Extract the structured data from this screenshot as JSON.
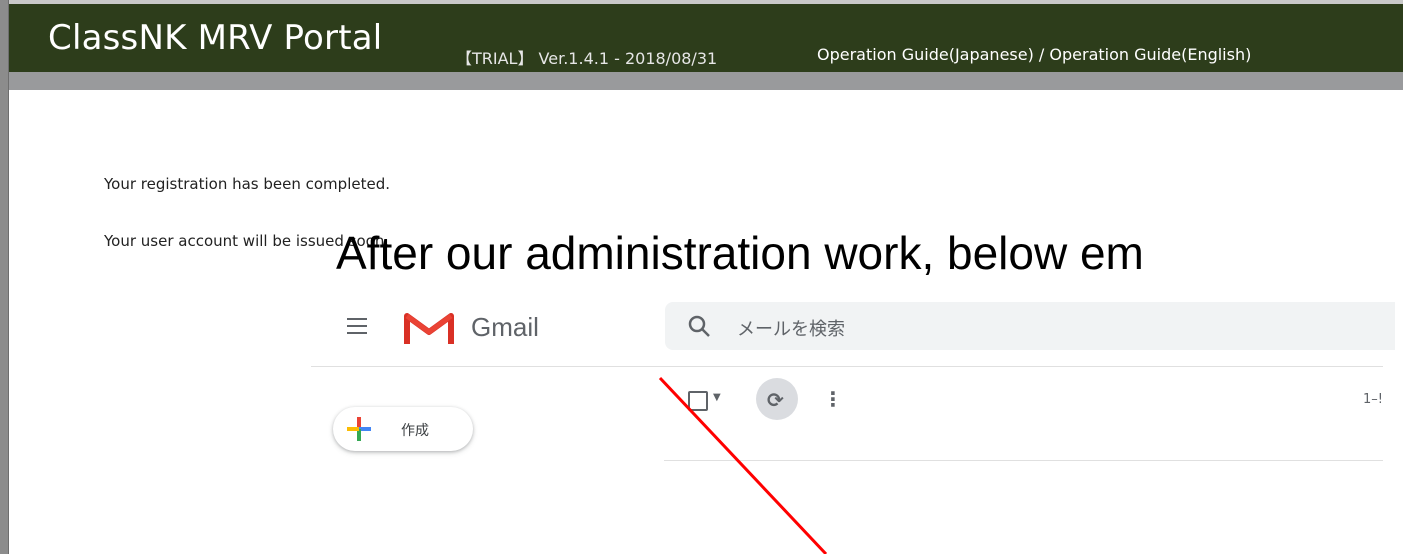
{
  "header": {
    "title": "ClassNK MRV Portal",
    "version": "【TRIAL】 Ver.1.4.1 - 2018/08/31",
    "guide_ja": "Operation Guide(Japanese)",
    "separator": " / ",
    "guide_en": "Operation Guide(English)"
  },
  "messages": {
    "line1": "Your registration has been completed.",
    "line2": "Your user account will be issued soon."
  },
  "annotation": {
    "text": "After our administration work, below em"
  },
  "gmail": {
    "app_name": "Gmail",
    "search_placeholder": "メールを検索",
    "compose_label": "作成",
    "range_text": "1–!",
    "icons": [
      "menu-icon",
      "gmail-logo-icon",
      "search-icon",
      "compose-plus-icon",
      "checkbox-icon",
      "refresh-icon",
      "more-vert-icon"
    ]
  },
  "colors": {
    "header_bg": "#2d3d1b",
    "annotation_arrow": "#ff0000",
    "search_bg": "#f1f3f4"
  }
}
